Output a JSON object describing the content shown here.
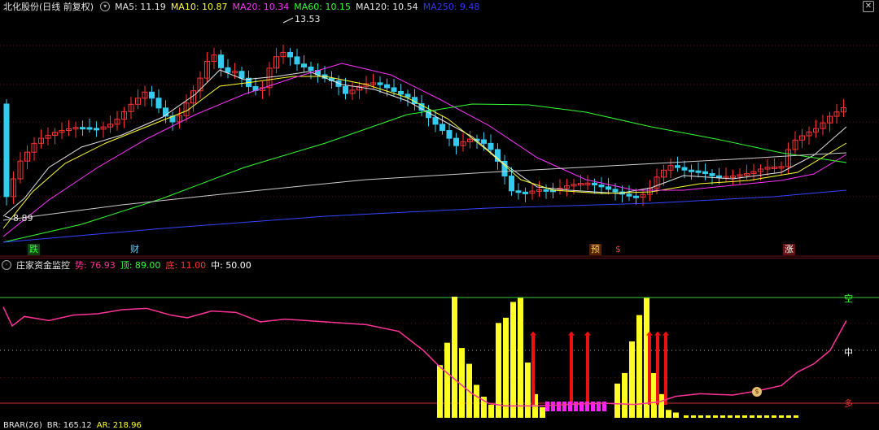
{
  "price_header": {
    "title": "北化股份(日线 前复权)",
    "ma_items": [
      {
        "label": "MA5: 11.19",
        "color": "#e6e6e6"
      },
      {
        "label": "MA10: 10.87",
        "color": "#ffff33"
      },
      {
        "label": "MA20: 10.34",
        "color": "#ff33ff"
      },
      {
        "label": "MA60: 10.15",
        "color": "#33ff33"
      },
      {
        "label": "MA120: 10.54",
        "color": "#e6e6e6"
      },
      {
        "label": "MA250: 9.48",
        "color": "#3333ff"
      }
    ],
    "close_icon": "✕"
  },
  "price_chart": {
    "high_label": "13.53",
    "low_label": "8.89",
    "signals": [
      {
        "text": "跌",
        "color": "#33ff33"
      },
      {
        "text": "财",
        "color": "#66ccff"
      },
      {
        "text": "预",
        "color": "#ffcc66"
      },
      {
        "text": "$",
        "color": "#ff3333"
      },
      {
        "text": "涨",
        "color": "#ffffff"
      }
    ]
  },
  "indicator_header": {
    "title": "庄家资金监控",
    "items": [
      {
        "label": "势: 76.93",
        "color": "#ff3399"
      },
      {
        "label": "顶: 89.00",
        "color": "#33ff33"
      },
      {
        "label": "底: 11.00",
        "color": "#ff3333"
      },
      {
        "label": "中: 50.00",
        "color": "#ffffff"
      }
    ]
  },
  "indicator_chart": {
    "label_top": "空",
    "label_mid": "中",
    "label_bottom": "多",
    "money_icon": "money-bag-icon"
  },
  "brar_header": {
    "title": "BRAR(26)",
    "items": [
      {
        "label": "BR: 165.12",
        "color": "#e6e6e6"
      },
      {
        "label": "AR: 218.96",
        "color": "#ffff33"
      }
    ]
  },
  "chart_data": [
    {
      "type": "candlestick",
      "title": "北化股份(日线 前复权)",
      "series": [
        {
          "name": "MA5",
          "last": 11.19
        },
        {
          "name": "MA10",
          "last": 10.87
        },
        {
          "name": "MA20",
          "last": 10.34
        },
        {
          "name": "MA60",
          "last": 10.15
        },
        {
          "name": "MA120",
          "last": 10.54
        },
        {
          "name": "MA250",
          "last": 9.48
        }
      ],
      "annotations": [
        "13.53",
        "8.89"
      ],
      "grid": true
    },
    {
      "type": "line",
      "title": "庄家资金监控",
      "series": [
        {
          "name": "势",
          "last": 76.93
        },
        {
          "name": "顶",
          "last": 89.0
        },
        {
          "name": "底",
          "last": 11.0
        },
        {
          "name": "中",
          "last": 50.0
        }
      ],
      "ylim": [
        0,
        100
      ],
      "grid": true
    }
  ]
}
